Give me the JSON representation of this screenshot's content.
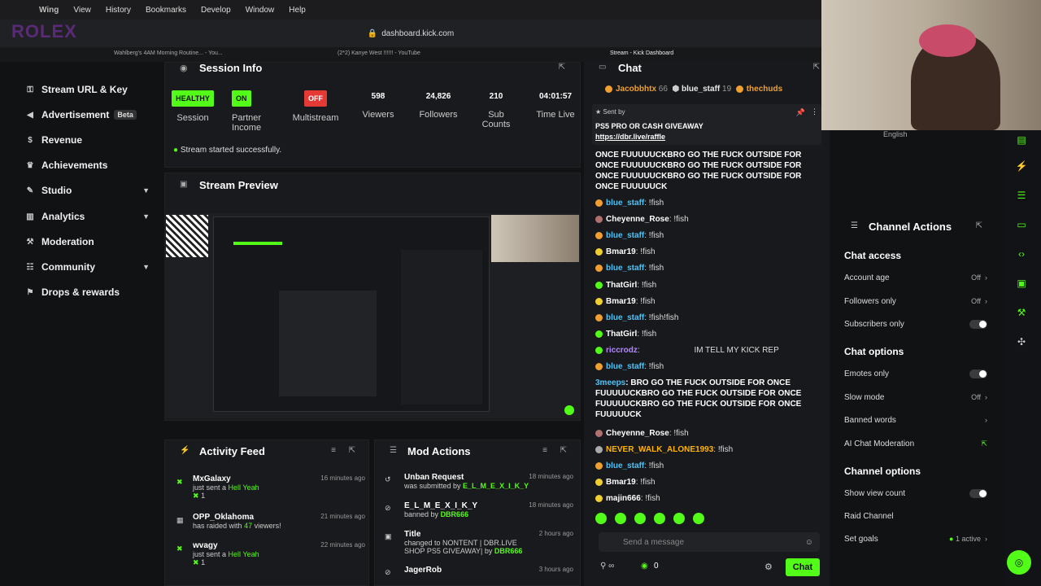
{
  "menubar": {
    "app": "Wing",
    "items": [
      "View",
      "History",
      "Bookmarks",
      "Develop",
      "Window",
      "Help"
    ]
  },
  "browser": {
    "url": "dashboard.kick.com",
    "tabs": [
      "Wahlberg's 4AM Morning Routine... - You...",
      "(2*2) Kanye West !!!!!! - YouTube",
      "Stream - Kick Dashboard"
    ]
  },
  "overlay_logo": "ROLEX",
  "sidebar": {
    "items": [
      {
        "label": "Stream URL & Key",
        "icon": "key-icon"
      },
      {
        "label": "Advertisement",
        "icon": "megaphone-icon",
        "badge": "Beta"
      },
      {
        "label": "Revenue",
        "icon": "dollar-icon"
      },
      {
        "label": "Achievements",
        "icon": "trophy-icon"
      },
      {
        "label": "Studio",
        "icon": "pencil-icon"
      },
      {
        "label": "Analytics",
        "icon": "chart-icon"
      },
      {
        "label": "Moderation",
        "icon": "wrench-icon"
      },
      {
        "label": "Community",
        "icon": "users-icon"
      },
      {
        "label": "Drops & rewards",
        "icon": "gift-icon"
      }
    ]
  },
  "session": {
    "title": "Session Info",
    "stats": [
      {
        "value": "HEALTHY",
        "label": "Session",
        "color": "#53fc18"
      },
      {
        "value": "ON",
        "label": "Partner Income",
        "color": "#53fc18"
      },
      {
        "value": "OFF",
        "label": "Multistream",
        "color": "#e53935"
      },
      {
        "value": "598",
        "label": "Viewers"
      },
      {
        "value": "24,826",
        "label": "Followers"
      },
      {
        "value": "210",
        "label": "Sub Counts"
      },
      {
        "value": "04:01:57",
        "label": "Time Live"
      }
    ],
    "status": "Stream started successfully."
  },
  "preview": {
    "title": "Stream Preview"
  },
  "activity": {
    "title": "Activity Feed",
    "items": [
      {
        "name": "MxGalaxy",
        "action": "just sent a",
        "highlight": "Hell Yeah",
        "count": "1",
        "time": "16 minutes ago"
      },
      {
        "name": "OPP_Oklahoma",
        "action": "has raided with",
        "highlight": "47",
        "tail": "viewers!",
        "time": "21 minutes ago"
      },
      {
        "name": "wvagy",
        "action": "just sent a",
        "highlight": "Hell Yeah",
        "count": "1",
        "time": "22 minutes ago"
      }
    ]
  },
  "mod": {
    "title": "Mod Actions",
    "items": [
      {
        "title": "Unban Request",
        "desc": "was submitted by",
        "user": "E_L_M_E_X_I_K_Y",
        "time": "18 minutes ago"
      },
      {
        "title": "E_L_M_E_X_I_K_Y",
        "desc": "banned by",
        "user": "DBR666",
        "time": "18 minutes ago"
      },
      {
        "title": "Title",
        "desc": "changed to NONTENT | DBR.LIVE SHOP PS5 GIVEAWAY| by",
        "user": "DBR666",
        "time": "2 hours ago"
      },
      {
        "title": "JagerRob",
        "desc": "",
        "user": "",
        "time": "3 hours ago"
      }
    ]
  },
  "chat": {
    "title": "Chat",
    "top_chatters": [
      {
        "name": "Jacobbhtx",
        "count": "66"
      },
      {
        "name": "blue_staff",
        "count": "19"
      },
      {
        "name": "thechuds",
        "count": ""
      }
    ],
    "pinned": {
      "sender": "Sent by",
      "title": "PS5 PRO OR CASH GIVEAWAY",
      "link": "https://dbr.live/raffle"
    },
    "messages": [
      {
        "user": "",
        "text": "ONCE FUUUUUCKBRO GO THE FUCK OUTSIDE FOR ONCE FUUUUUCKBRO GO THE FUCK OUTSIDE FOR ONCE FUUUUUCKBRO GO THE FUCK OUTSIDE FOR ONCE FUUUUUCK",
        "color": "#ffffff"
      },
      {
        "user": "blue_staff",
        "text": "!fish",
        "color": "#4fc3f7"
      },
      {
        "user": "Cheyenne_Rose",
        "text": "!fish",
        "color": "#ffffff"
      },
      {
        "user": "blue_staff",
        "text": "!fish",
        "color": "#4fc3f7"
      },
      {
        "user": "Bmar19",
        "text": "!fish",
        "color": "#ffffff"
      },
      {
        "user": "blue_staff",
        "text": "!fish",
        "color": "#4fc3f7"
      },
      {
        "user": "ThatGirl",
        "text": "!fish",
        "color": "#ffffff"
      },
      {
        "user": "Bmar19",
        "text": "!fish",
        "color": "#ffffff"
      },
      {
        "user": "blue_staff",
        "text": "!fish!fish",
        "color": "#4fc3f7"
      },
      {
        "user": "ThatGirl",
        "text": "!fish",
        "color": "#ffffff"
      },
      {
        "user": "riccrodz",
        "text": "IM TELL MY KICK REP",
        "color": "#b388ff"
      },
      {
        "user": "blue_staff",
        "text": "!fish",
        "color": "#4fc3f7"
      },
      {
        "user": "3meeps",
        "text": "BRO GO THE FUCK OUTSIDE FOR ONCE FUUUUUCKBRO GO THE FUCK OUTSIDE FOR ONCE FUUUUUCKBRO GO THE FUCK OUTSIDE FOR ONCE FUUUUUCK",
        "color": "#4fc3f7"
      },
      {
        "user": "Cheyenne_Rose",
        "text": "!fish",
        "color": "#ffffff"
      },
      {
        "user": "NEVER_WALK_ALONE1993",
        "text": "!fish",
        "color": "#ffb300"
      },
      {
        "user": "blue_staff",
        "text": "!fish",
        "color": "#4fc3f7"
      },
      {
        "user": "Bmar19",
        "text": "!fish",
        "color": "#ffffff"
      },
      {
        "user": "majin666",
        "text": "!fish",
        "color": "#ffffff"
      }
    ],
    "input_placeholder": "Send a message",
    "points": "0",
    "send_label": "Chat"
  },
  "actions": {
    "title": "Channel Actions",
    "sections": [
      {
        "title": "Chat access",
        "rows": [
          {
            "label": "Account age",
            "value": "Off",
            "kind": "arrow"
          },
          {
            "label": "Followers only",
            "value": "Off",
            "kind": "arrow"
          },
          {
            "label": "Subscribers only",
            "value": "",
            "kind": "toggle"
          }
        ]
      },
      {
        "title": "Chat options",
        "rows": [
          {
            "label": "Emotes only",
            "value": "",
            "kind": "toggle"
          },
          {
            "label": "Slow mode",
            "value": "Off",
            "kind": "arrow"
          },
          {
            "label": "Banned words",
            "value": "",
            "kind": "arrow"
          },
          {
            "label": "AI Chat Moderation",
            "value": "",
            "kind": "link"
          }
        ]
      },
      {
        "title": "Channel options",
        "rows": [
          {
            "label": "Show view count",
            "value": "",
            "kind": "toggle"
          },
          {
            "label": "Raid Channel",
            "value": "",
            "kind": "none"
          },
          {
            "label": "Set goals",
            "value": "1 active",
            "kind": "arrow"
          }
        ]
      }
    ]
  },
  "webcam_caption": "English",
  "colors": {
    "accent": "#53fc18",
    "danger": "#e53935"
  }
}
